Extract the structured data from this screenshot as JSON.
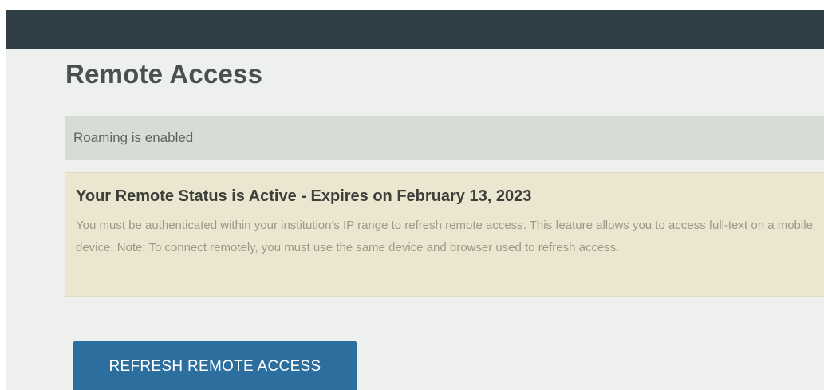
{
  "page": {
    "title": "Remote Access"
  },
  "roaming": {
    "message": "Roaming is enabled"
  },
  "status": {
    "heading": "Your Remote Status is Active - Expires on February 13, 2023",
    "description": "You must be authenticated within your institution's IP range to refresh remote access. This feature allows you to access full-text on a mobile device. Note: To connect remotely, you must use the same device and browser used to refresh access."
  },
  "actions": {
    "refresh_label": "REFRESH REMOTE ACCESS"
  },
  "colors": {
    "header_bar": "#2f3d45",
    "roaming_banner": "#d8dcd7",
    "status_panel": "#ebe6cf",
    "primary_button": "#2c6f9f"
  }
}
